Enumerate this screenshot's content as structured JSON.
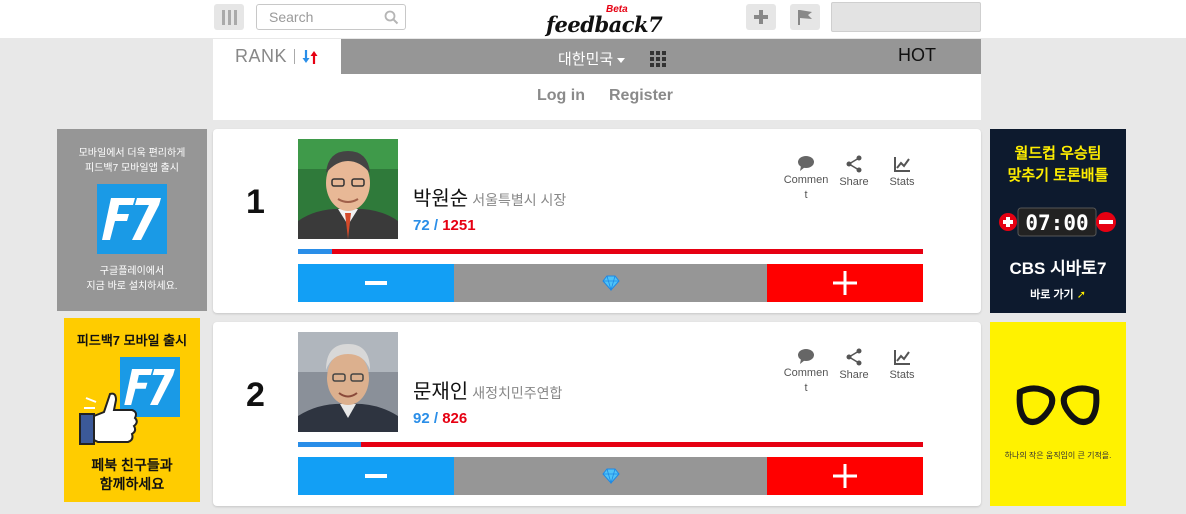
{
  "header": {
    "search_placeholder": "Search",
    "logo_text": "feedback7",
    "logo_badge": "Beta",
    "icons": [
      "menu-icon",
      "search-icon",
      "plus-icon",
      "flag-icon"
    ]
  },
  "tabs": {
    "rank_label": "RANK",
    "region_label": "대한민국",
    "hot_label": "HOT"
  },
  "auth": {
    "login_label": "Log in",
    "register_label": "Register"
  },
  "ads": {
    "left_top": {
      "line1": "모바일에서 더욱 편리하게",
      "line2": "피드백7 모바일앱 출시",
      "line3": "구글플레이에서",
      "line4": "지금 바로 설치하세요."
    },
    "left_bottom": {
      "line1": "피드백7 모바일 출시",
      "line2": "페북 친구들과",
      "line3": "함께하세요"
    },
    "right_top": {
      "line1": "월드컵 우승팀",
      "line2": "맞추기 토론배틀",
      "clock": "07:00",
      "line3": "CBS 시바토7",
      "line4": "바로 가기"
    },
    "right_bottom": {
      "caption": "하나의 작은 움직임이 큰 기적을."
    }
  },
  "colors": {
    "accent_blue": "#129ff5",
    "accent_red": "#ff0000",
    "neutral_gray": "#969696"
  },
  "rankings": [
    {
      "rank": "1",
      "name": "박원순",
      "title": "서울특별시 시장",
      "up": "72",
      "sep": "/",
      "down": "1251",
      "ratio_up": 0.054,
      "actions": {
        "comment_a": "Commen",
        "comment_b": "t",
        "share": "Share",
        "stats": "Stats"
      }
    },
    {
      "rank": "2",
      "name": "문재인",
      "title": "새정치민주연합",
      "up": "92",
      "sep": "/",
      "down": "826",
      "ratio_up": 0.1,
      "actions": {
        "comment_a": "Commen",
        "comment_b": "t",
        "share": "Share",
        "stats": "Stats"
      }
    }
  ]
}
